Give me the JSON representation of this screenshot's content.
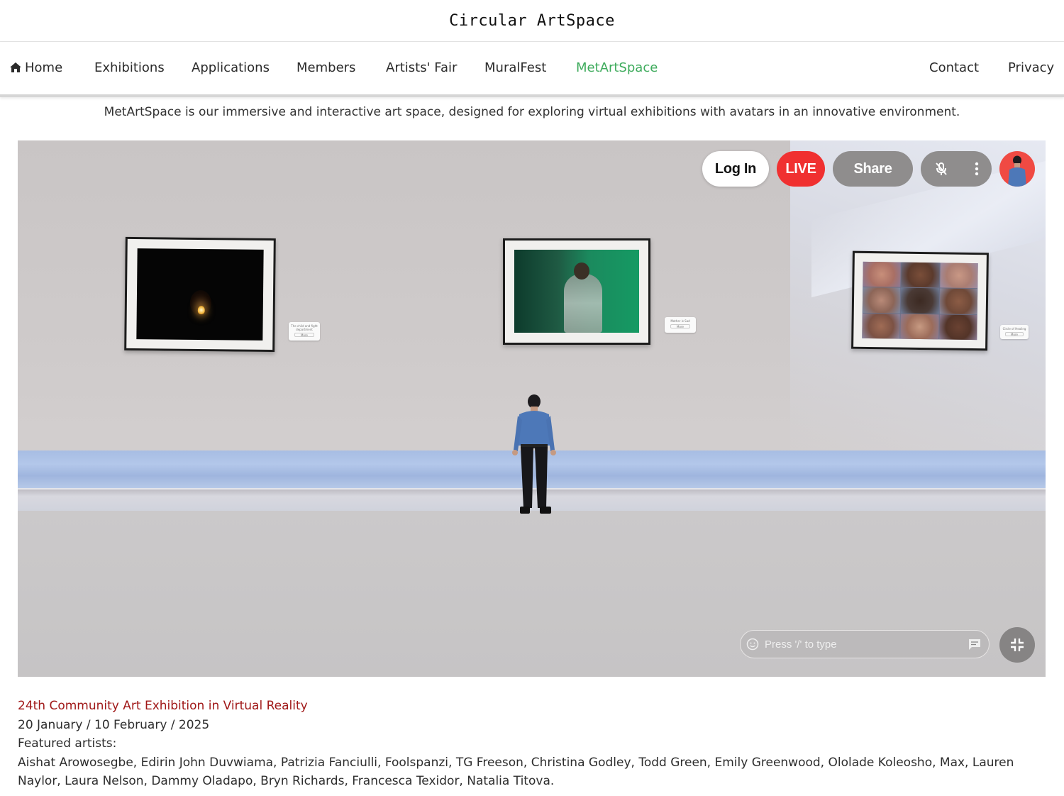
{
  "site": {
    "title": "Circular ArtSpace"
  },
  "nav": {
    "home": "Home",
    "exhibitions": "Exhibitions",
    "applications": "Applications",
    "members": "Members",
    "artists_fair": "Artists' Fair",
    "muralfest": "MuralFest",
    "metartspace": "MetArtSpace",
    "contact": "Contact",
    "privacy": "Privacy",
    "active": "MetArtSpace",
    "active_color": "#3eab5c"
  },
  "intro": "MetArtSpace is our immersive and interactive art space, designed for exploring virtual exhibitions with avatars in an innovative environment.",
  "viewer": {
    "login_label": "Log In",
    "live_label": "LIVE",
    "share_label": "Share",
    "mic_icon": "mic-off-icon",
    "more_icon": "more-vertical-icon",
    "chat_placeholder": "Press '/' to type",
    "live_color": "#f03030",
    "plaques": [
      {
        "title": "The child and fight department",
        "button": "More"
      },
      {
        "title": "Mother is Sad",
        "button": "More"
      },
      {
        "title": "Circle of Healing",
        "button": "More"
      }
    ]
  },
  "exhibition": {
    "title": "24th Community Art Exhibition in Virtual Reality",
    "dates": "20 January / 10 February / 2025",
    "featured_label": "Featured artists:",
    "artists": "Aishat Arowosegbe, Edirin John Duvwiama, Patrizia Fanciulli, Foolspanzi, TG Freeson, Christina Godley, Todd Green, Emily Greenwood, Ololade Koleosho, Max, Lauren Naylor, Laura Nelson, Dammy Oladapo, Bryn Richards, Francesca Texidor, Natalia Titova.",
    "title_color": "#a01818"
  }
}
